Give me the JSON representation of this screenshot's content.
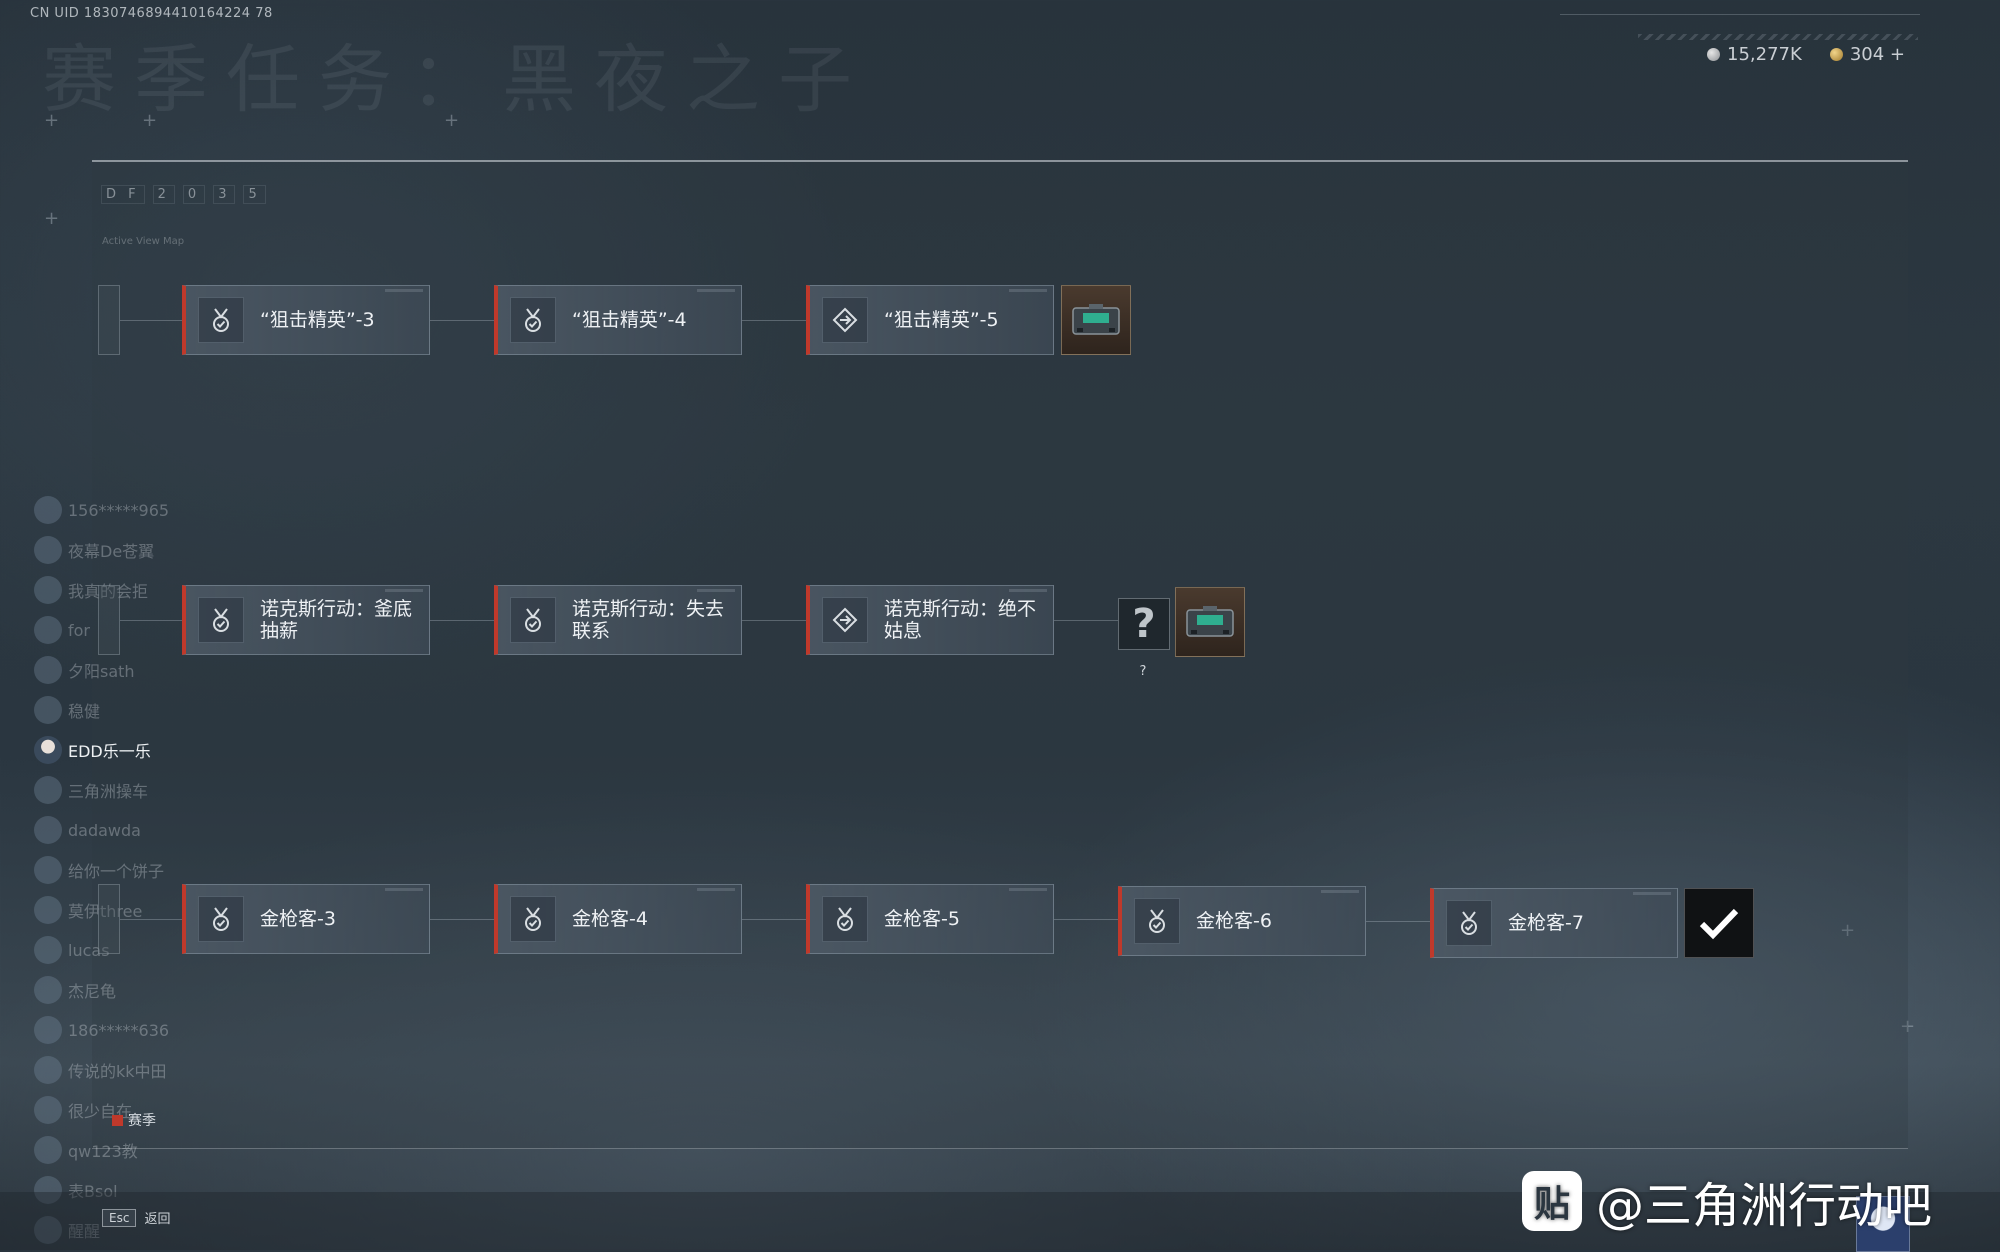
{
  "header": {
    "uid": "CN UID 1830746894410164224 78",
    "title": "赛季任务：黑夜之子",
    "currency": [
      {
        "icon": "silver-coin-icon",
        "value": "15,277K"
      },
      {
        "icon": "gold-coin-icon",
        "value": "304 +"
      }
    ]
  },
  "panel": {
    "tabs": [
      "D F",
      "2",
      "0",
      "3",
      "5"
    ],
    "subtitle": "Active View Map"
  },
  "friends": [
    {
      "name": "156*****965"
    },
    {
      "name": "夜幕De苍翼"
    },
    {
      "name": "我真的会拒"
    },
    {
      "name": "for"
    },
    {
      "name": "夕阳sath"
    },
    {
      "name": "稳健"
    },
    {
      "name": "EDD乐一乐",
      "active": true
    },
    {
      "name": "三角洲操车"
    },
    {
      "name": "dadawda"
    },
    {
      "name": "给你一个饼子"
    },
    {
      "name": "莫伊three"
    },
    {
      "name": "lucas"
    },
    {
      "name": "杰尼龟"
    },
    {
      "name": "186*****636"
    },
    {
      "name": "传说的kk中田"
    },
    {
      "name": "很少自在"
    },
    {
      "name": "qw123教"
    },
    {
      "name": "表Bsol"
    },
    {
      "name": "醒醒"
    }
  ],
  "chains": {
    "sniper": [
      {
        "label": "“狙击精英”-3",
        "icon": "medal-check-icon"
      },
      {
        "label": "“狙击精英”-4",
        "icon": "medal-check-icon"
      },
      {
        "label": "“狙击精英”-5",
        "icon": "diamond-arrow-icon"
      }
    ],
    "nox": [
      {
        "label": "诺克斯行动：釜底抽薪",
        "icon": "medal-check-icon"
      },
      {
        "label": "诺克斯行动：失去联系",
        "icon": "medal-check-icon"
      },
      {
        "label": "诺克斯行动：绝不姑息",
        "icon": "diamond-arrow-icon"
      }
    ],
    "golden": [
      {
        "label": "金枪客-3",
        "icon": "medal-check-icon"
      },
      {
        "label": "金枪客-4",
        "icon": "medal-check-icon"
      },
      {
        "label": "金枪客-5",
        "icon": "medal-check-icon"
      },
      {
        "label": "金枪客-6",
        "icon": "medal-check-icon"
      },
      {
        "label": "金枪客-7",
        "icon": "medal-check-icon"
      }
    ]
  },
  "mystery": {
    "symbol": "?",
    "hint": "?"
  },
  "footer": {
    "season_label": "赛季",
    "esc_key": "Esc",
    "esc_label": "返回"
  },
  "watermark": {
    "logo": "贴",
    "text": "@三角洲行动吧"
  },
  "colors": {
    "accent": "#c0392b",
    "background": "#2c3841",
    "card": "#4e5a66"
  }
}
